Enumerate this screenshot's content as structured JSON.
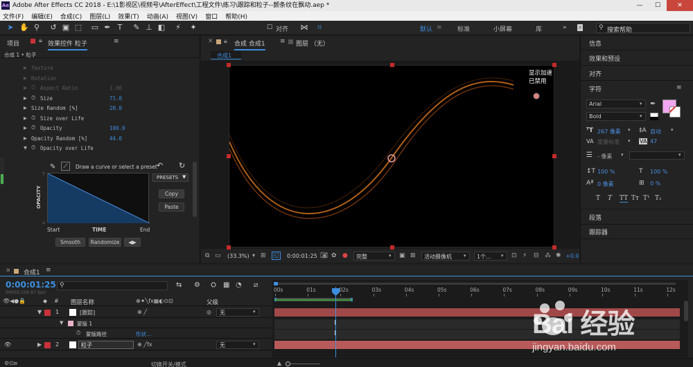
{
  "window": {
    "title": "Adobe After Effects CC 2018 - E:\\1影视区\\视频号\\AfterEffect\\工程文件\\练习\\跟踪和粒子--颤条纹在飘动.aep *",
    "logo": "Ae",
    "min": "—",
    "max": "☐",
    "close": "✕"
  },
  "menu": [
    "文件(F)",
    "编辑(E)",
    "合成(C)",
    "图层(L)",
    "效果(T)",
    "动画(A)",
    "视图(V)",
    "窗口",
    "帮助(H)"
  ],
  "toolbar": {
    "align_label": "对齐",
    "workspaces": [
      "默认",
      "标准",
      "小屏幕",
      "库"
    ],
    "active_workspace": "默认",
    "search_placeholder": "搜索帮助"
  },
  "left_panel": {
    "tab_project": "项目",
    "tab_effects": "效果控件 粒子",
    "breadcrumb": "合成 1 • 粒子",
    "props": [
      {
        "label": "Texture",
        "value": "",
        "dim": true,
        "sw": false
      },
      {
        "label": "Rotation",
        "value": "",
        "dim": true,
        "sw": false
      },
      {
        "label": "Aspect Ratio",
        "value": "1.00",
        "dim": true,
        "sw": true
      },
      {
        "label": "Size",
        "value": "71.0",
        "dim": false,
        "sw": true
      },
      {
        "label": "Size Random [%]",
        "value": "20.0",
        "dim": false,
        "sw": false
      },
      {
        "label": "Size over Life",
        "value": "",
        "dim": false,
        "sw": true
      },
      {
        "label": "Opacity",
        "value": "100.0",
        "dim": false,
        "sw": true
      },
      {
        "label": "Opacity Random [%]",
        "value": "44.0",
        "dim": false,
        "sw": false
      },
      {
        "label": "Opacity over Life",
        "value": "",
        "dim": false,
        "sw": true
      }
    ],
    "curve_hint": "Draw a curve or select a preset",
    "presets_label": "PRESETS",
    "copy_label": "Copy",
    "paste_label": "Paste",
    "y_axis_label": "OPACITY",
    "x_start": "Start",
    "x_mid": "TIME",
    "x_end": "End",
    "smooth_label": "Smooth",
    "randomize_label": "Randomize"
  },
  "comp_panel": {
    "tab_comp": "合成 合成1",
    "tab_layer": "图层 （无）",
    "sub_tab": "合成1",
    "notice": "显示加速已禁用",
    "zoom": "(33.3%)",
    "timecode": "0:00:01:25",
    "resolution": "完整",
    "camera": "活动摄像机",
    "views": "1个...",
    "exposure": "+0.0"
  },
  "right_panel": {
    "items": [
      "信息",
      "效果和预设",
      "对齐",
      "字符"
    ],
    "font": "Arial",
    "style": "Bold",
    "font_size": "267 像素",
    "leading": "自动",
    "kerning": "度量标准",
    "tracking": "47",
    "stroke": "- 像素",
    "vscale": "100 %",
    "hscale": "100 %",
    "baseline": "0 像素",
    "tsume": "0 %",
    "text_styles": [
      "T",
      "T",
      "TT",
      "Tт",
      "T¹",
      "T₁"
    ],
    "paragraph": "段落",
    "tracker": "跟踪器",
    "fill_color": "#f0a6f0"
  },
  "timeline": {
    "tab": "合成1",
    "timecode": "0:00:01:25",
    "frames": "00055 (29.97 fps)",
    "search_placeholder": "",
    "col_layer_name": "图层名称",
    "col_parent": "父级",
    "layers": [
      {
        "num": "1",
        "name": "[跟踪]",
        "parent": "无"
      },
      {
        "num": "2",
        "name": "粒子",
        "parent": "无"
      }
    ],
    "mask_label": "蒙版 1",
    "mask_path_label": "蒙版路径",
    "mask_path_value": "形状...",
    "ruler": [
      "00s",
      "01s",
      "02s",
      "03s",
      "04s",
      "05s",
      "06s",
      "07s",
      "08s",
      "09s",
      "10s",
      "11s",
      "12s"
    ],
    "toggle_label": "切换开关/模式"
  },
  "watermark": {
    "text": "Bai 经验",
    "url": "jingyan.baidu.com"
  }
}
